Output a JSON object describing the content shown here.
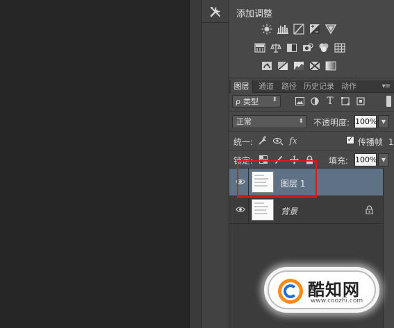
{
  "adjustments": {
    "title": "添加调整",
    "row1": [
      "brightness-contrast-icon",
      "levels-icon",
      "curves-icon",
      "exposure-icon",
      "vibrance-icon"
    ],
    "row2": [
      "hue-saturation-icon",
      "color-balance-icon",
      "black-white-icon",
      "photo-filter-icon",
      "channel-mixer-icon",
      "color-lookup-icon"
    ],
    "row3": [
      "invert-icon",
      "posterize-icon",
      "threshold-icon",
      "selective-color-icon",
      "gradient-map-icon"
    ]
  },
  "layers_panel": {
    "tabs": [
      "图层",
      "通道",
      "路径",
      "历史记录",
      "动作"
    ],
    "active_tab": "图层",
    "filter": {
      "label": "类型",
      "prefix": "ρ"
    },
    "blend_mode": "正常",
    "opacity_label": "不透明度:",
    "opacity_value": "100%",
    "unify_label": "统一:",
    "propagate_checked": "✓",
    "propagate_label": "传播帧",
    "propagate_value": "1",
    "lock_label": "锁定:",
    "fill_label": "填充:",
    "fill_value": "100%",
    "layers": [
      {
        "name": "图层 1",
        "visible": true,
        "selected": true,
        "locked": false
      },
      {
        "name": "背景",
        "visible": true,
        "selected": false,
        "locked": true
      }
    ]
  },
  "watermark": {
    "title": "酷知网",
    "url": "www.coozhi.com"
  },
  "colors": {
    "selected_layer": "#5f7185",
    "highlight": "#e01818",
    "panel_bg": "#484848",
    "canvas_bg": "#262626"
  }
}
